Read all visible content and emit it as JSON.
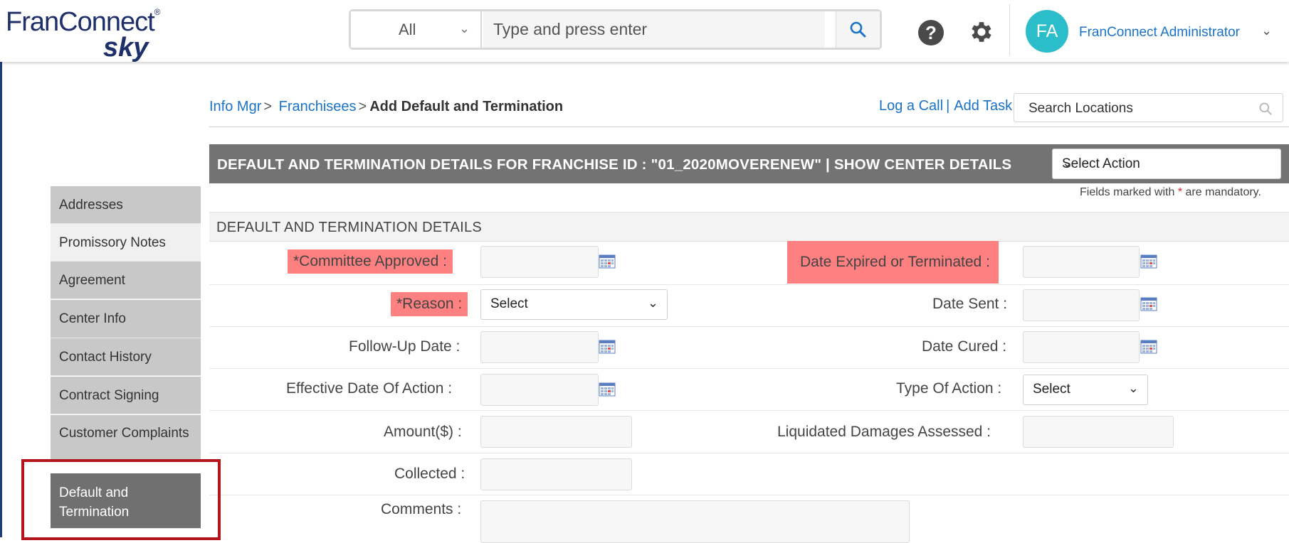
{
  "header": {
    "logo_top": "FranConnect",
    "logo_bottom": "sky",
    "logo_mark": "®",
    "search_scope": "All",
    "search_placeholder": "Type and press enter",
    "user_initials": "FA",
    "user_name": "FranConnect Administrator"
  },
  "breadcrumb": {
    "items": [
      "Info Mgr",
      "Franchisees"
    ],
    "separator": ">",
    "current": "Add Default and Termination"
  },
  "quick_links": {
    "log_call": "Log a Call",
    "add_task": "Add Task",
    "separator": "|",
    "location_search_placeholder": "Search Locations"
  },
  "details_bar": {
    "title": "DEFAULT AND TERMINATION DETAILS FOR FRANCHISE ID : \"01_2020MOVERENEW\" | SHOW CENTER DETAILS",
    "action_select": "Select Action"
  },
  "mandatory_note": {
    "prefix": "Fields marked with",
    "star": "*",
    "suffix": "are mandatory."
  },
  "section": {
    "title": "DEFAULT AND TERMINATION DETAILS"
  },
  "form": {
    "committee_approved": "*Committee Approved :",
    "date_expired": "Date Expired or Terminated :",
    "reason": "*Reason :",
    "reason_value": "Select",
    "date_sent": "Date Sent :",
    "follow_up": "Follow-Up Date :",
    "date_cured": "Date Cured :",
    "effective_date": "Effective Date Of Action :",
    "type_of_action": "Type Of Action :",
    "type_of_action_value": "Select",
    "amount": "Amount($) :",
    "liquidated": "Liquidated Damages Assessed :",
    "collected": "Collected :",
    "comments": "Comments :"
  },
  "leftnav": {
    "items": [
      {
        "label": "Addresses"
      },
      {
        "label": "Promissory Notes"
      },
      {
        "label": "Agreement"
      },
      {
        "label": "Center Info"
      },
      {
        "label": "Contact History"
      },
      {
        "label": "Contract Signing"
      },
      {
        "label": "Customer Complaints"
      },
      {
        "label": "Default and Termination"
      }
    ]
  },
  "colors": {
    "brand_navy": "#1f2f6b",
    "link_blue": "#1a73c7",
    "avatar_teal": "#2bbdc9",
    "highlight_red": "#ff8080",
    "annotation_red": "#b2151b",
    "bar_gray": "#737373"
  },
  "icons": [
    "search-icon",
    "help-icon",
    "gear-icon",
    "calendar-icon",
    "chevron-down-icon"
  ]
}
